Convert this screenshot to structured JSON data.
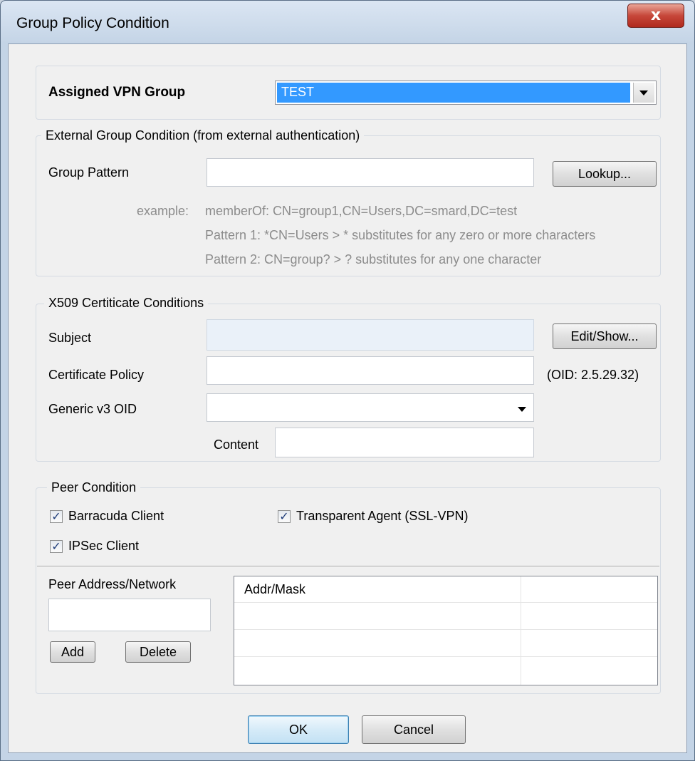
{
  "window": {
    "title": "Group Policy Condition",
    "close_icon": "x-icon",
    "close_glyph": "x"
  },
  "assigned": {
    "label": "Assigned VPN Group",
    "value": "TEST"
  },
  "external": {
    "legend": "External Group Condition (from external authentication)",
    "group_pattern_label": "Group Pattern",
    "group_pattern_value": "",
    "lookup_button": "Lookup...",
    "example_label": "example:",
    "example_line1": "memberOf: CN=group1,CN=Users,DC=smard,DC=test",
    "example_line2": "Pattern 1: *CN=Users   > * substitutes for any zero or more characters",
    "example_line3": "Pattern 2: CN=group?  > ? substitutes for any one character"
  },
  "x509": {
    "legend": "X509 Certiticate Conditions",
    "subject_label": "Subject",
    "subject_value": "",
    "edit_button": "Edit/Show...",
    "cert_policy_label": "Certificate Policy",
    "cert_policy_value": "",
    "oid_note": "(OID: 2.5.29.32)",
    "generic_label": "Generic v3 OID",
    "generic_value": "",
    "content_label": "Content",
    "content_value": ""
  },
  "peer": {
    "legend": "Peer Condition",
    "barracuda_label": "Barracuda Client",
    "barracuda_checked": true,
    "transparent_label": "Transparent Agent (SSL-VPN)",
    "transparent_checked": true,
    "ipsec_label": "IPSec Client",
    "ipsec_checked": true,
    "check_glyph": "✓",
    "address_label": "Peer Address/Network",
    "address_value": "",
    "add_button": "Add",
    "delete_button": "Delete",
    "table_columns": [
      "Addr/Mask",
      ""
    ],
    "table_rows": []
  },
  "footer": {
    "ok_button": "OK",
    "cancel_button": "Cancel"
  }
}
